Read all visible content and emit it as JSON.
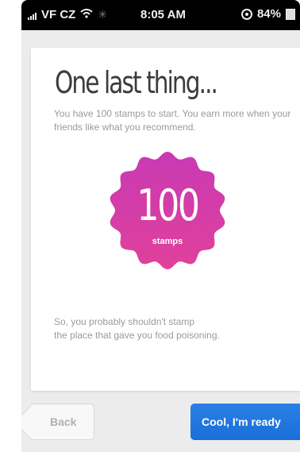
{
  "status_bar": {
    "carrier": "VF CZ",
    "time": "8:05 AM",
    "battery": "84%",
    "icons": [
      "signal-icon",
      "wifi-icon",
      "activity-spinner-icon",
      "rotation-lock-icon",
      "battery-icon"
    ]
  },
  "onboarding": {
    "title": "One last thing...",
    "subtitle": "You have 100 stamps to start. You earn more when your friends like what you recommend.",
    "badge": {
      "count": "100",
      "unit": "stamps",
      "color_top": "#c93ab4",
      "color_bottom": "#e0409a"
    },
    "note_line_1": "So, you probably shouldn't stamp",
    "note_line_2": "the place that gave you food poisoning."
  },
  "navigation": {
    "back_label": "Back",
    "primary_label": "Cool, I'm ready",
    "primary_color": "#2a80e6"
  }
}
